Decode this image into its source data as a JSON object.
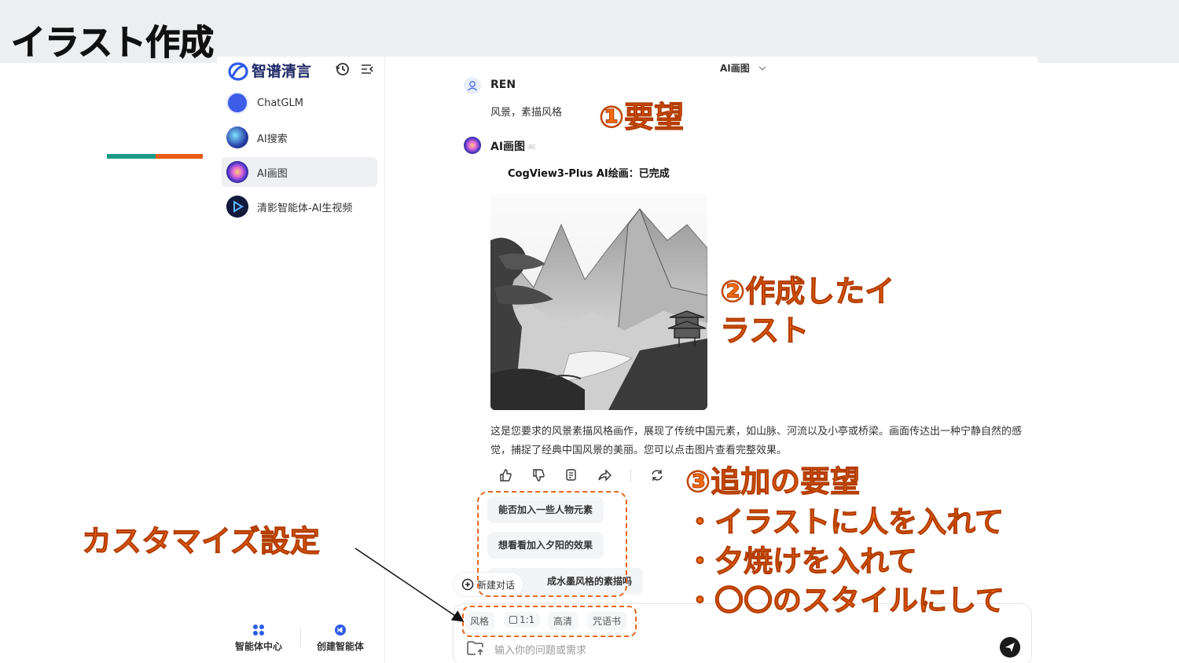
{
  "slide": {
    "title": "イラスト作成"
  },
  "sidebar": {
    "brand": "智谱清言",
    "items": [
      {
        "label": "ChatGLM",
        "icon": "chatglm-icon"
      },
      {
        "label": "AI搜索",
        "icon": "ai-search-icon"
      },
      {
        "label": "AI画图",
        "icon": "ai-draw-icon",
        "active": true
      },
      {
        "label": "清影智能体-AI生视频",
        "icon": "qingying-video-icon"
      }
    ],
    "bottom": {
      "agent_center": "智能体中心",
      "create_agent": "创建智能体"
    }
  },
  "chat": {
    "model_selector": "AI画图",
    "user": {
      "name": "REN",
      "message": "风景，素描风格"
    },
    "bot": {
      "name": "AI画图",
      "tag": "AI",
      "status": "CogView3-Plus AI绘画：已完成",
      "description": "这是您要求的风景素描风格画作，展现了传统中国元素，如山脉、河流以及小亭或桥梁。画面传达出一种宁静自然的感觉，捕捉了经典中国风景的美丽。您可以点击图片查看完整效果。"
    },
    "suggestions": [
      "能否加入一些人物元素",
      "想看看加入夕阳的效果",
      "成水墨风格的素描吗"
    ],
    "new_chat": "新建对话"
  },
  "composer": {
    "chips": [
      "风格",
      "1:1",
      "高清",
      "咒语书"
    ],
    "placeholder": "输入你的问题或需求"
  },
  "annotations": {
    "request": "①要望",
    "created": "②作成したイ",
    "created_line2": "ラスト",
    "additional": "③追加の要望",
    "add_person": "・イラストに人を入れて",
    "add_sunset": "・夕焼けを入れて",
    "add_style": "・〇〇のスタイルにして",
    "customize": "カスタマイズ設定"
  },
  "colors": {
    "annotation": "#f26a12",
    "brand": "#1d2766",
    "accent_green": "#1a9a86",
    "accent_orange": "#e85d12"
  }
}
